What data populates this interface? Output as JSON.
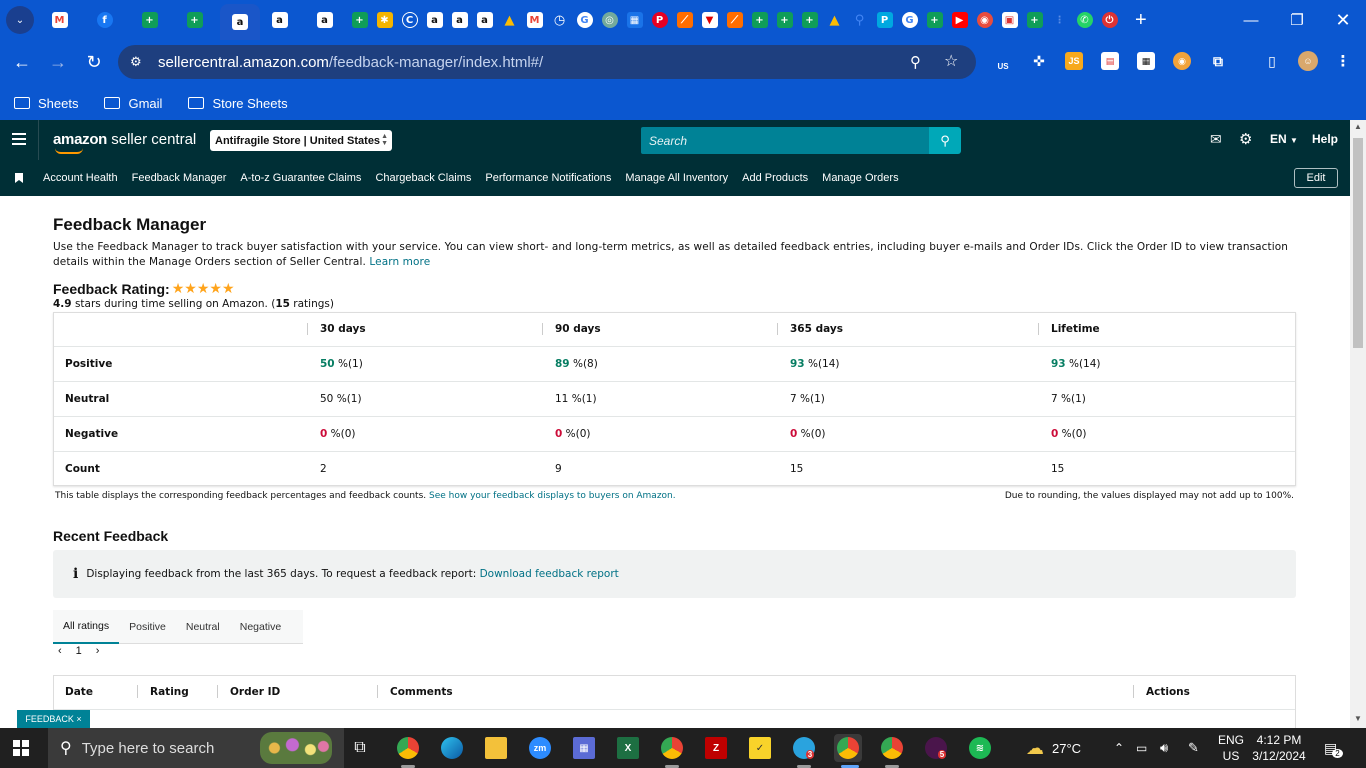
{
  "browser": {
    "url_host": "sellercentral.amazon.com",
    "url_path": "/feedback-manager/index.html#/",
    "bookmarks": [
      "Sheets",
      "Gmail",
      "Store Sheets"
    ],
    "extension_badge_us": "US",
    "extension_js": "JS"
  },
  "header": {
    "logo_main": "amazon",
    "logo_sub": "seller central",
    "store_selector": "Antifragile Store | United States",
    "search_placeholder": "Search",
    "lang": "EN",
    "help": "Help"
  },
  "nav": {
    "items": [
      "Account Health",
      "Feedback Manager",
      "A-to-z Guarantee Claims",
      "Chargeback Claims",
      "Performance Notifications",
      "Manage All Inventory",
      "Add Products",
      "Manage Orders"
    ],
    "edit": "Edit"
  },
  "page": {
    "title": "Feedback Manager",
    "description": "Use the Feedback Manager to track buyer satisfaction with your service. You can view short- and long-term metrics, as well as detailed feedback entries, including buyer e-mails and Order IDs. Click the Order ID to view transaction details within the Manage Orders section of Seller Central.",
    "learn_more": "Learn more",
    "rating_title": "Feedback Rating:",
    "rating_value": "4.9",
    "rating_stars": 5,
    "rating_sub_mid": " stars during time selling on Amazon. (",
    "rating_count": "15",
    "rating_sub_end": " ratings)"
  },
  "metrics": {
    "columns": [
      "30 days",
      "90 days",
      "365 days",
      "Lifetime"
    ],
    "rows": [
      {
        "label": "Positive",
        "cells": [
          {
            "v": "50",
            "n": " %(1)"
          },
          {
            "v": "89",
            "n": " %(8)"
          },
          {
            "v": "93",
            "n": " %(14)"
          },
          {
            "v": "93",
            "n": " %(14)"
          }
        ],
        "style": "green"
      },
      {
        "label": "Neutral",
        "cells": [
          {
            "v": "50",
            "n": " %(1)"
          },
          {
            "v": "11",
            "n": " %(1)"
          },
          {
            "v": "7",
            "n": " %(1)"
          },
          {
            "v": "7",
            "n": " %(1)"
          }
        ],
        "style": "plain"
      },
      {
        "label": "Negative",
        "cells": [
          {
            "v": "0",
            "n": " %(0)"
          },
          {
            "v": "0",
            "n": " %(0)"
          },
          {
            "v": "0",
            "n": " %(0)"
          },
          {
            "v": "0",
            "n": " %(0)"
          }
        ],
        "style": "red"
      },
      {
        "label": "Count",
        "cells": [
          {
            "v": "2",
            "n": ""
          },
          {
            "v": "9",
            "n": ""
          },
          {
            "v": "15",
            "n": ""
          },
          {
            "v": "15",
            "n": ""
          }
        ],
        "style": "plain"
      }
    ],
    "note_left": "This table displays the corresponding feedback percentages and feedback counts.",
    "note_link": "See how your feedback displays to buyers on Amazon.",
    "note_right": "Due to rounding, the values displayed may not add up to 100%."
  },
  "recent": {
    "title": "Recent Feedback",
    "info_text": "Displaying feedback from the last 365 days. To request a feedback report:",
    "info_link": "Download feedback report",
    "tabs": [
      "All ratings",
      "Positive",
      "Neutral",
      "Negative"
    ],
    "page": "1",
    "headers": [
      "Date",
      "Rating",
      "Order ID",
      "Comments",
      "Actions"
    ]
  },
  "feedback_tag": "FEEDBACK",
  "taskbar": {
    "search_placeholder": "Type here to search",
    "temperature": "27°C",
    "lang_top": "ENG",
    "lang_bottom": "US",
    "time": "4:12 PM",
    "date": "3/12/2024",
    "notif_count": "2",
    "badge_telegram": "3",
    "badge_slack": "5"
  },
  "colors": {
    "chrome_blue": "#0b57d0",
    "sc_dark": "#002f36",
    "teal": "#008296",
    "positive_green": "#067d62",
    "negative_red": "#cc0c39",
    "star_orange": "#ffa41c"
  }
}
